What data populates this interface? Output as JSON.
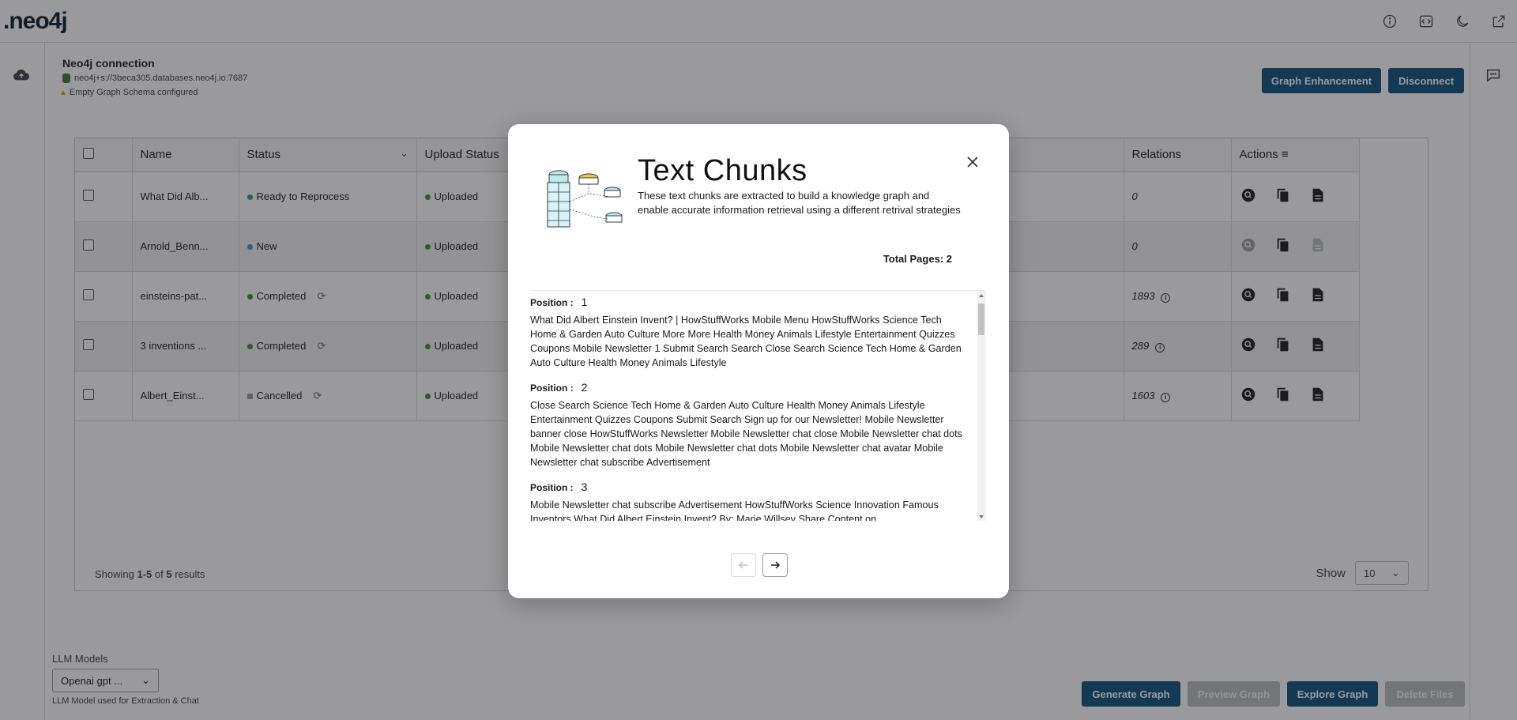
{
  "app": {
    "logo": ".neo4j"
  },
  "header": {
    "icons": [
      "info-icon",
      "code-icon",
      "moon-icon",
      "external-link-icon"
    ]
  },
  "connection": {
    "title": "Neo4j connection",
    "uri": "neo4j+s://3beca305.databases.neo4j.io:7687",
    "warning": "Empty Graph Schema configured"
  },
  "buttons": {
    "graph_enhancement": "Graph Enhancement",
    "disconnect": "Disconnect",
    "generate_graph": "Generate Graph",
    "preview_graph": "Preview Graph",
    "explore_graph": "Explore Graph",
    "delete_files": "Delete Files"
  },
  "table": {
    "headers": {
      "name": "Name",
      "status": "Status",
      "upload_status": "Upload Status",
      "relations": "Relations",
      "actions": "Actions"
    },
    "rows": [
      {
        "name": "What Did Alb...",
        "status": "Ready to Reprocess",
        "upload": "Uploaded",
        "relations": "0"
      },
      {
        "name": "Arnold_Benn...",
        "status": "New",
        "upload": "Uploaded",
        "relations": "0"
      },
      {
        "name": "einsteins-pat...",
        "status": "Completed",
        "upload": "Uploaded",
        "relations": "1893"
      },
      {
        "name": "3 inventions ...",
        "status": "Completed",
        "upload": "Uploaded",
        "relations": "289"
      },
      {
        "name": "Albert_Einst...",
        "status": "Cancelled",
        "upload": "Uploaded",
        "relations": "1603"
      }
    ],
    "showing_prefix": "Showing ",
    "showing_range": "1-5",
    "showing_of": " of ",
    "showing_total": "5",
    "showing_suffix": " results",
    "show_label": "Show",
    "page_size": "10"
  },
  "llm": {
    "label": "LLM Models",
    "selected": "Openai gpt ...",
    "hint": "LLM Model used for Extraction & Chat"
  },
  "modal": {
    "title": "Text Chunks",
    "description": "These text chunks are extracted to build a knowledge graph and enable accurate information retrieval using a different retrival strategies",
    "total_pages": "Total Pages: 2",
    "position_label": "Position :",
    "chunks": [
      {
        "position": "1",
        "text": "What Did Albert Einstein Invent? | HowStuffWorks Mobile Menu HowStuffWorks Science Tech Home & Garden Auto Culture More More Health Money Animals Lifestyle Entertainment Quizzes Coupons Mobile Newsletter 1 Submit Search Search Close Search Science Tech Home & Garden Auto Culture Health Money Animals Lifestyle"
      },
      {
        "position": "2",
        "text": "Close Search Science Tech Home & Garden Auto Culture Health Money Animals Lifestyle Entertainment Quizzes Coupons Submit Search Sign up for our Newsletter! Mobile Newsletter banner close  HowStuffWorks Newsletter Mobile Newsletter chat close Mobile Newsletter chat dots Mobile Newsletter chat dots Mobile Newsletter chat dots Mobile Newsletter chat avatar Mobile Newsletter chat subscribe Advertisement"
      },
      {
        "position": "3",
        "text": "Mobile Newsletter chat subscribe Advertisement HowStuffWorks Science Innovation Famous Inventors What Did Albert Einstein Invent? By: Marie Willsey Share Content on"
      }
    ]
  },
  "colors": {
    "accent": "#0a4f7f",
    "disabled": "#b9bcc0",
    "status_green": "#3b8d2f"
  }
}
